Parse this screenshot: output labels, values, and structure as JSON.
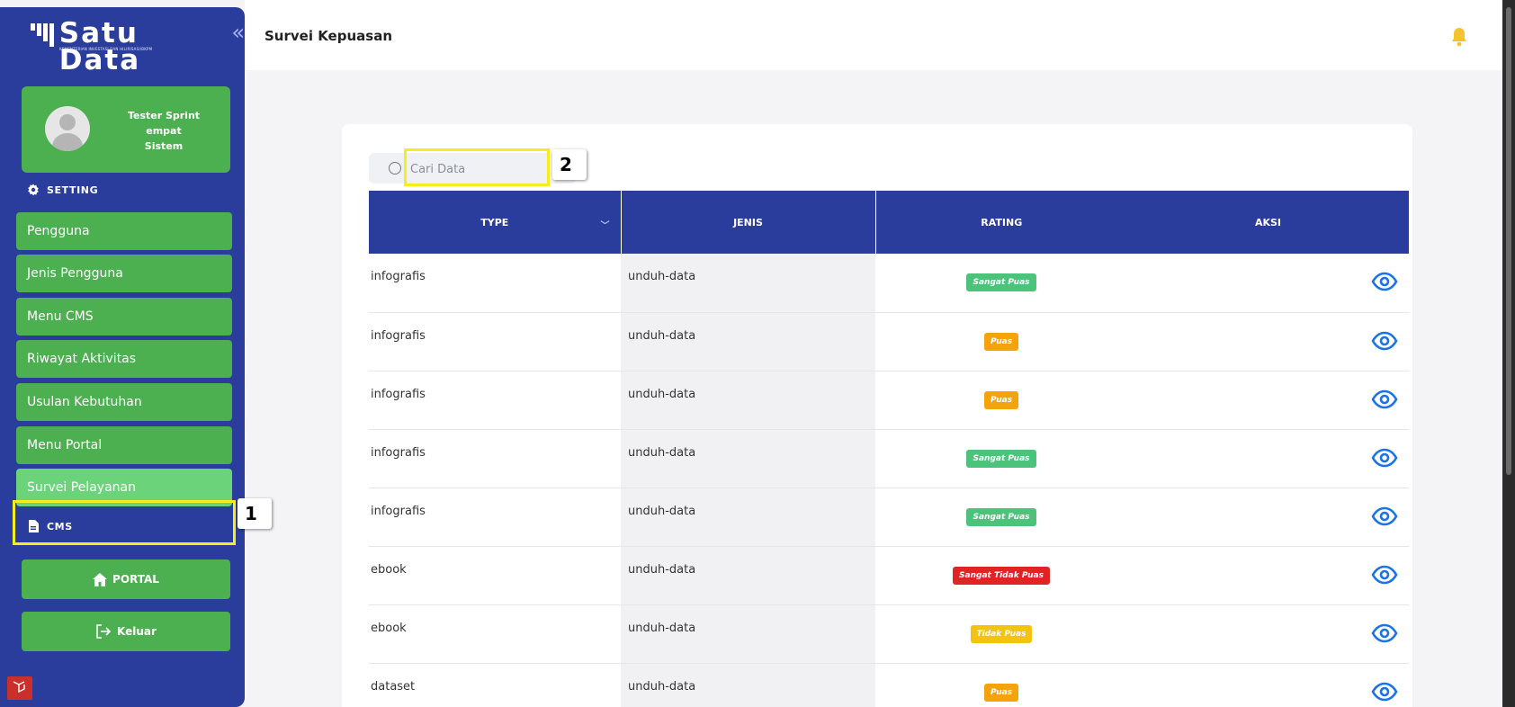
{
  "app": {
    "logo_title": "Satu Data",
    "logo_subtitle": "KEMENTERIAN INVESTASI DAN HILIRISASI/BKPM"
  },
  "profile": {
    "name_line1": "Tester Sprint",
    "name_line2": "empat",
    "role": "Sistem"
  },
  "sidebar": {
    "setting_label": "SETTING",
    "items": [
      {
        "label": "Pengguna"
      },
      {
        "label": "Jenis Pengguna"
      },
      {
        "label": "Menu CMS"
      },
      {
        "label": "Riwayat Aktivitas"
      },
      {
        "label": "Usulan Kebutuhan"
      },
      {
        "label": "Menu Portal"
      },
      {
        "label": "Survei Pelayanan",
        "active": true
      }
    ],
    "cms_label": "CMS",
    "portal_label": "PORTAL",
    "logout_label": "Keluar"
  },
  "annotations": {
    "callout_1": "1",
    "callout_2": "2"
  },
  "header": {
    "title": "Survei Kepuasan"
  },
  "search": {
    "placeholder": "Cari Data",
    "value": ""
  },
  "table": {
    "columns": [
      "TYPE",
      "JENIS",
      "RATING",
      "AKSI"
    ],
    "rows": [
      {
        "type": "infografis",
        "jenis": "unduh-data",
        "rating": "Sangat Puas"
      },
      {
        "type": "infografis",
        "jenis": "unduh-data",
        "rating": "Puas"
      },
      {
        "type": "infografis",
        "jenis": "unduh-data",
        "rating": "Puas"
      },
      {
        "type": "infografis",
        "jenis": "unduh-data",
        "rating": "Sangat Puas"
      },
      {
        "type": "infografis",
        "jenis": "unduh-data",
        "rating": "Sangat Puas"
      },
      {
        "type": "ebook",
        "jenis": "unduh-data",
        "rating": "Sangat Tidak Puas"
      },
      {
        "type": "ebook",
        "jenis": "unduh-data",
        "rating": "Tidak Puas"
      },
      {
        "type": "dataset",
        "jenis": "unduh-data",
        "rating": "Puas"
      }
    ]
  },
  "colors": {
    "primary": "#2b3d9c",
    "menu_green": "#4caf50",
    "menu_active": "#6bd47a",
    "highlight": "#f4ee1c",
    "rating_sangat_puas": "#4cc37a",
    "rating_puas": "#f5a30a",
    "rating_tidak_puas": "#f2c40f",
    "rating_sangat_tidak_puas": "#e02424",
    "eye_icon": "#1a73e8",
    "bell": "#f5c330"
  }
}
